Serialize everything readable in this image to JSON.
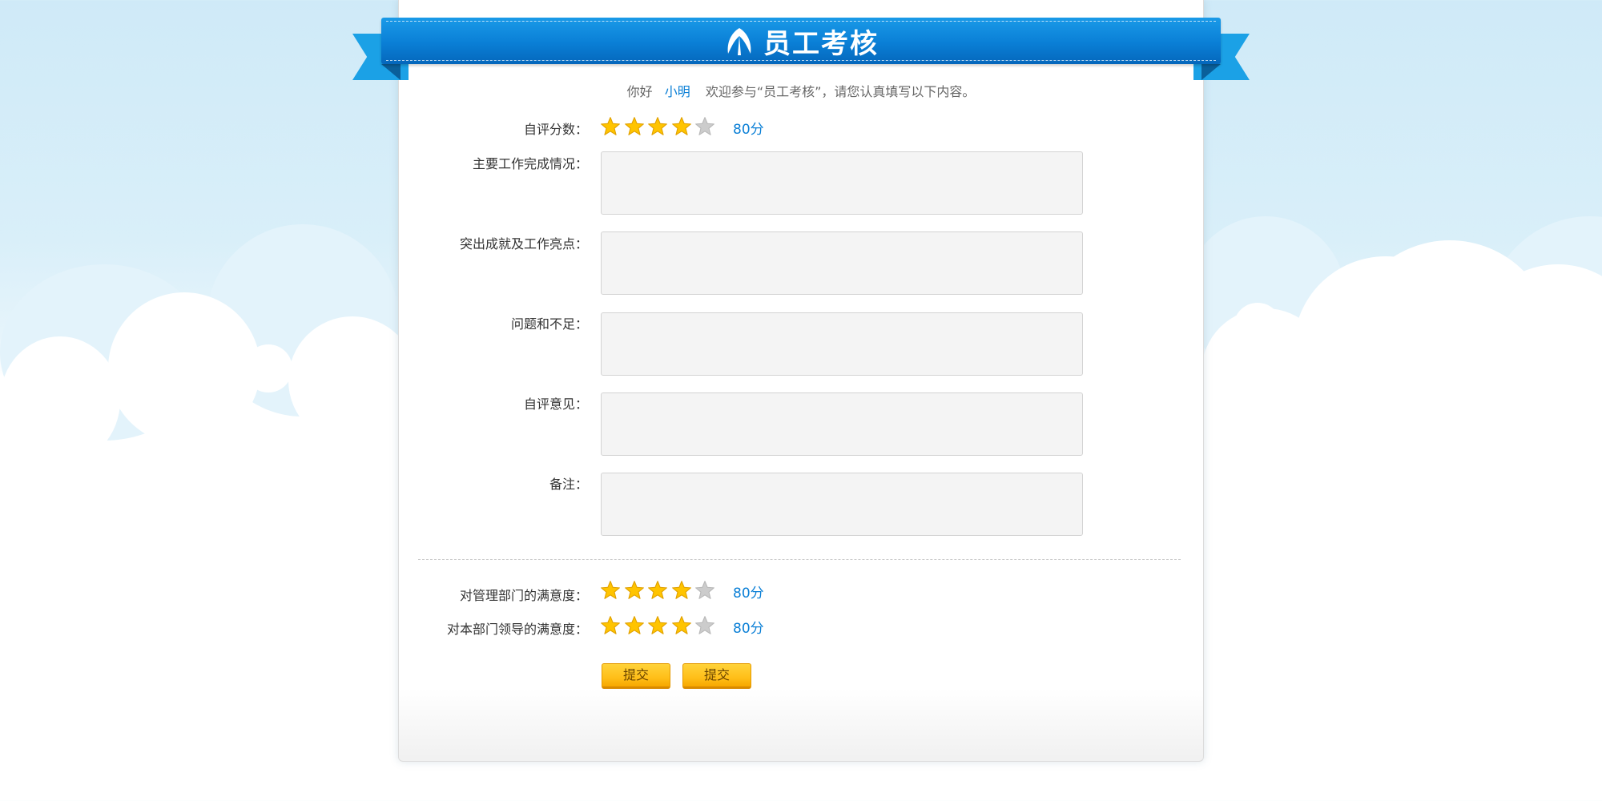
{
  "header": {
    "title": "员工考核",
    "logo_icon": "leaf-logo-icon",
    "ribbon_color": "#0a7fd6"
  },
  "greeting": {
    "prefix": "你好",
    "user_name": "小明",
    "message": "欢迎参与“员工考核”，请您认真填写以下内容。"
  },
  "self_score": {
    "label": "自评分数：",
    "rating": 4,
    "max_rating": 5,
    "score_text": "80分"
  },
  "fields": [
    {
      "label": "主要工作完成情况：",
      "value": ""
    },
    {
      "label": "突出成就及工作亮点：",
      "value": ""
    },
    {
      "label": "问题和不足：",
      "value": ""
    },
    {
      "label": "自评意见：",
      "value": ""
    },
    {
      "label": "备注：",
      "value": ""
    }
  ],
  "satisfaction": [
    {
      "label": "对管理部门的满意度：",
      "rating": 4,
      "max_rating": 5,
      "score_text": "80分"
    },
    {
      "label": "对本部门领导的满意度：",
      "rating": 4,
      "max_rating": 5,
      "score_text": "80分"
    }
  ],
  "buttons": {
    "submit_1": "提交",
    "submit_2": "提交"
  },
  "colors": {
    "accent": "#0a7fd6",
    "star_filled": "#ffc400",
    "star_empty": "#cccccc",
    "button": "#ffbf1a"
  }
}
